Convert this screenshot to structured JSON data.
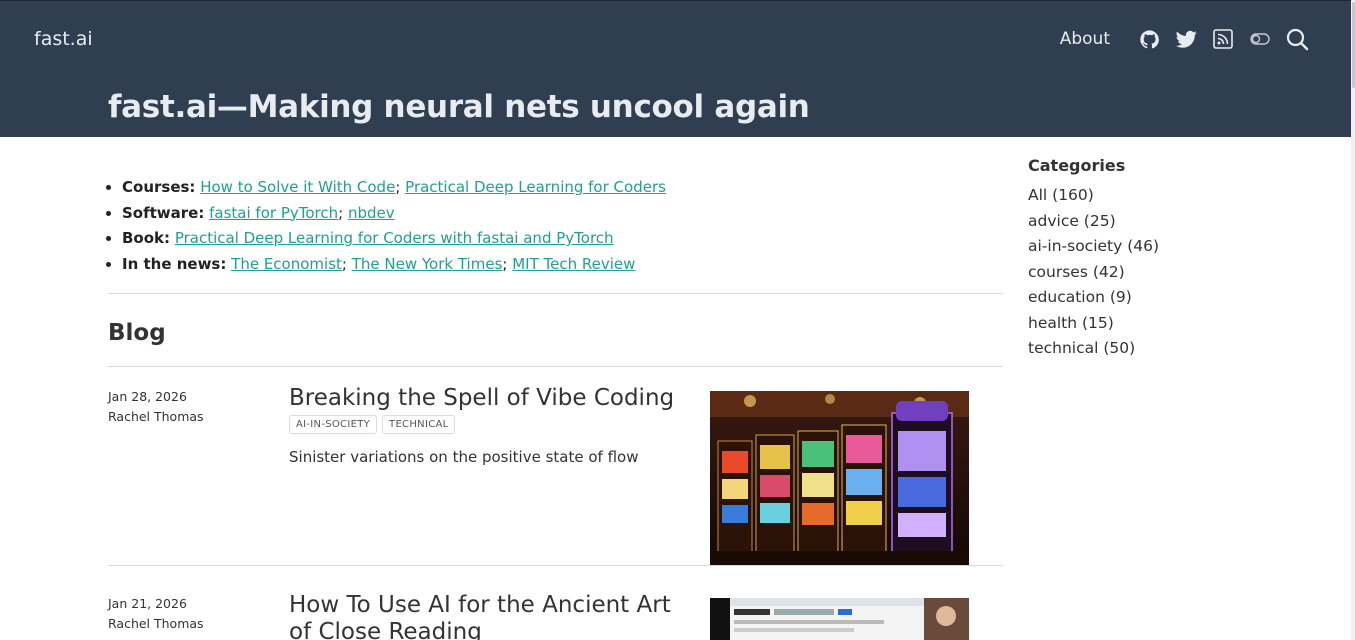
{
  "header": {
    "brand": "fast.ai",
    "nav_about": "About",
    "title": "fast.ai—Making neural nets uncool again",
    "icons": [
      "github-icon",
      "twitter-icon",
      "rss-icon",
      "toggle-icon",
      "search-icon"
    ]
  },
  "links": {
    "courses": {
      "label": "Courses:",
      "a1": "How to Solve it With Code",
      "sep": ";",
      "a2": "Practical Deep Learning for Coders"
    },
    "software": {
      "label": "Software:",
      "a1": "fastai for PyTorch",
      "sep": ";",
      "a2": "nbdev"
    },
    "book": {
      "label": "Book:",
      "a1": "Practical Deep Learning for Coders with fastai and PyTorch"
    },
    "news": {
      "label": "In the news:",
      "a1": "The Economist",
      "a2": "The New York Times",
      "a3": "MIT Tech Review",
      "sep": ";"
    }
  },
  "blog": {
    "heading": "Blog",
    "posts": [
      {
        "date": "Jan 28, 2026",
        "author": "Rachel Thomas",
        "title": "Breaking the Spell of Vibe Coding",
        "tags": [
          "AI-IN-SOCIETY",
          "TECHNICAL"
        ],
        "description": "Sinister variations on the positive state of flow"
      },
      {
        "date": "Jan 21, 2026",
        "author": "Rachel Thomas",
        "title_line1": "How To Use AI for the Ancient Art",
        "title_line2": "of Close Reading"
      }
    ]
  },
  "sidebar": {
    "title": "Categories",
    "categories": [
      "All (160)",
      "advice (25)",
      "ai-in-society (46)",
      "courses (42)",
      "education (9)",
      "health (15)",
      "technical (50)"
    ]
  },
  "colors": {
    "header_bg": "#2f3e51",
    "link": "#1fa090",
    "text": "#333333"
  }
}
